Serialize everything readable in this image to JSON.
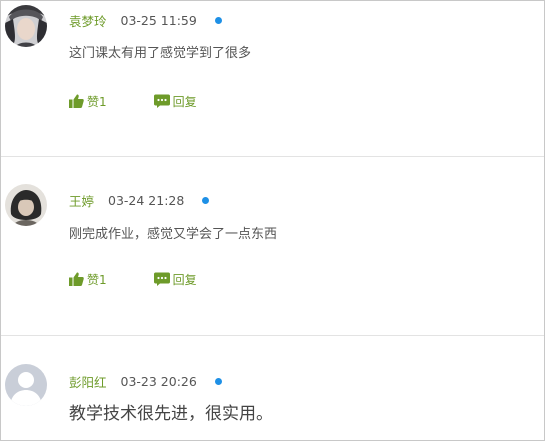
{
  "comments": [
    {
      "username": "袁梦玲",
      "time": "03-25 11:59",
      "text": "这门课太有用了感觉学到了很多",
      "like_label": "赞1",
      "reply_label": "回复"
    },
    {
      "username": "王婷",
      "time": "03-24 21:28",
      "text": "刚完成作业，感觉又学会了一点东西",
      "like_label": "赞1",
      "reply_label": "回复"
    },
    {
      "username": "彭阳红",
      "time": "03-23 20:26",
      "text": "教学技术很先进，很实用。"
    }
  ],
  "colors": {
    "username": "#6e9b2a",
    "status_dot": "#1e90e6",
    "action": "#6e9b2a",
    "divider": "#e3e3e3"
  },
  "icons": [
    "thumbs-up-icon",
    "reply-bubble-icon",
    "status-dot-icon"
  ]
}
